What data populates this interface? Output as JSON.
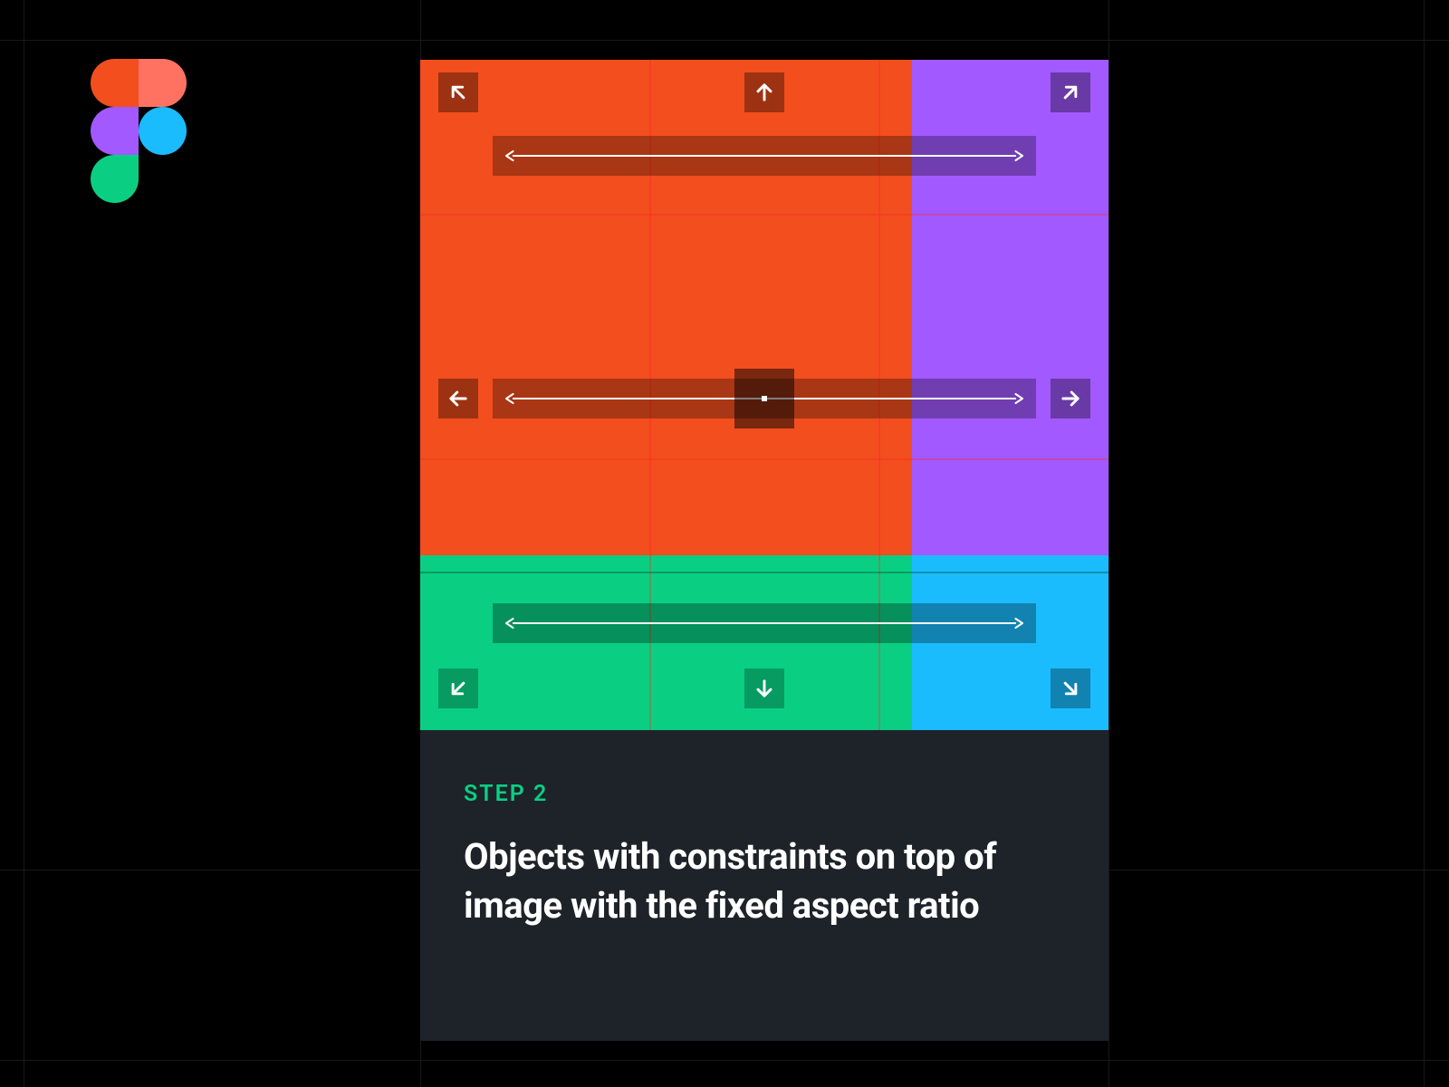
{
  "logo": {
    "name": "Figma"
  },
  "card": {
    "step_label": "STEP 2",
    "caption": "Objects with constraints on top of image with the fixed aspect ratio"
  },
  "blocks": {
    "top_left": "orange",
    "top_right": "purple",
    "bottom_left": "green",
    "bottom_right": "blue"
  },
  "constraints": {
    "corners": [
      "top-left",
      "top",
      "top-right",
      "left",
      "center",
      "right",
      "bottom-left",
      "bottom",
      "bottom-right"
    ],
    "stretch_bars": [
      "top-horizontal",
      "middle-horizontal",
      "bottom-horizontal"
    ]
  },
  "colors": {
    "orange": "#f24e1e",
    "orange_light": "#ff7262",
    "purple": "#a259ff",
    "green": "#0acf83",
    "blue": "#1abcfe",
    "caption_bg": "#1e2329"
  }
}
